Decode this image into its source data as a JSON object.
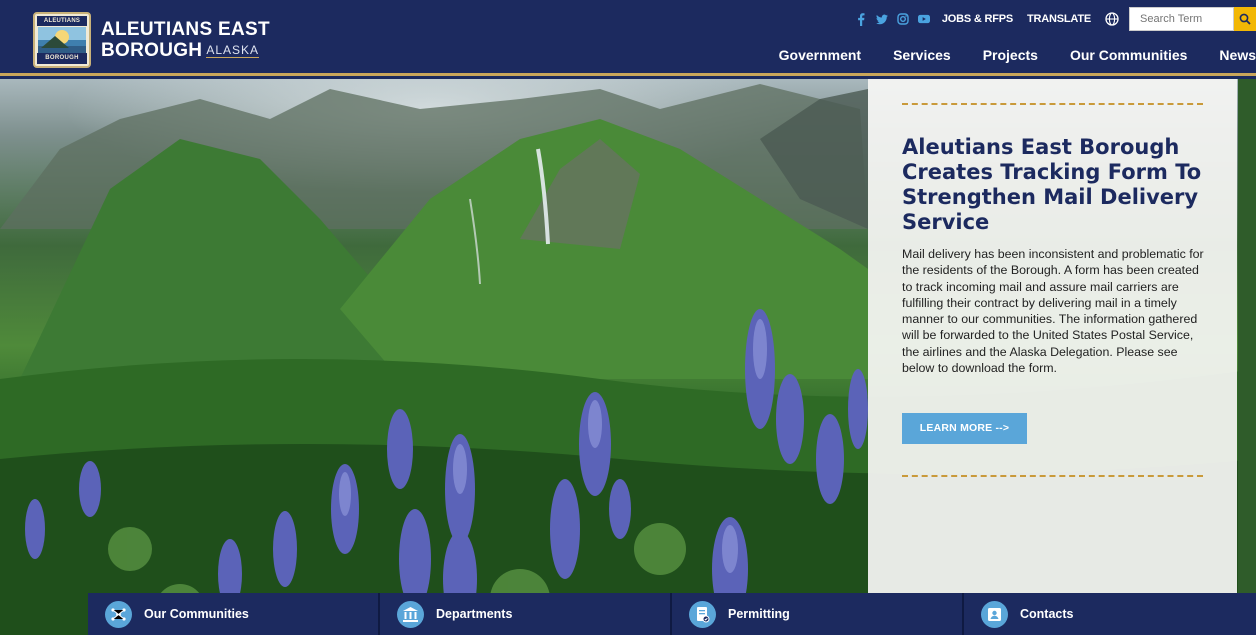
{
  "brand": {
    "name_line1": "ALEUTIANS EAST",
    "name_line2": "BOROUGH",
    "state": "ALASKA",
    "seal_top": "ALEUTIANS EAST",
    "seal_bottom": "BOROUGH"
  },
  "utility": {
    "social": [
      "facebook-icon",
      "twitter-icon",
      "instagram-icon",
      "youtube-icon"
    ],
    "jobs_label": "JOBS & RFPS",
    "translate_label": "TRANSLATE",
    "search_placeholder": "Search Term"
  },
  "nav": {
    "items": [
      "Government",
      "Services",
      "Projects",
      "Our Communities",
      "News"
    ]
  },
  "story": {
    "title": "Aleutians East Borough Creates Tracking Form To Strengthen Mail Delivery Service",
    "body": "Mail delivery has been inconsistent and problematic for the residents of the Borough. A form has been created to track incoming mail and assure mail carriers are fulfilling their contract by delivering mail in a timely manner to our communities. The information gathered will be forwarded to the United States Postal Service, the airlines and the Alaska Delegation. Please see below to download the form.",
    "button_label": "LEARN MORE  -->"
  },
  "quick_links": [
    {
      "label": "Our Communities",
      "icon": "communities-icon"
    },
    {
      "label": "Departments",
      "icon": "departments-icon"
    },
    {
      "label": "Permitting",
      "icon": "permitting-icon"
    },
    {
      "label": "Contacts",
      "icon": "contacts-icon"
    }
  ],
  "colors": {
    "navy": "#1c2a5f",
    "gold": "#c9a65a",
    "accent_blue": "#5aa6d9",
    "search_yellow": "#f2b705"
  }
}
